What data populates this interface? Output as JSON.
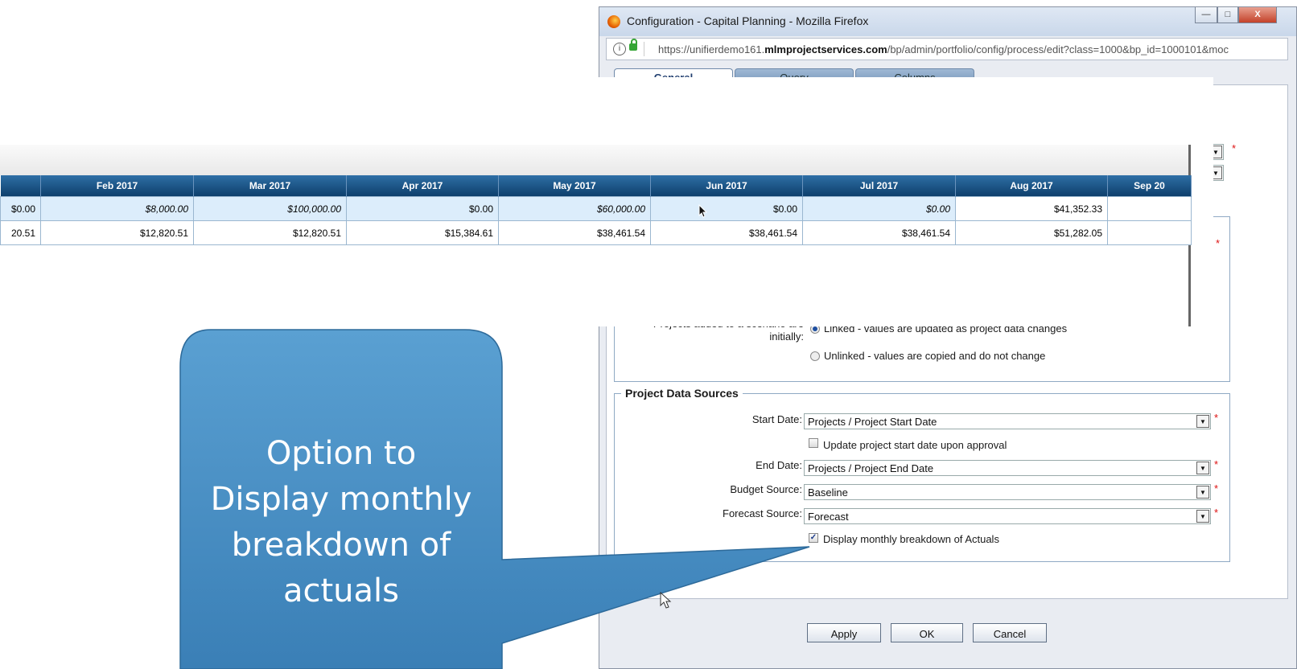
{
  "window": {
    "title": "Configuration - Capital Planning - Mozilla Firefox",
    "min": "—",
    "max": "□",
    "close": "X"
  },
  "url": {
    "prefix": "https://unifierdemo161.",
    "domain": "mlmprojectservices.com",
    "path": "/bp/admin/portfolio/config/process/edit?class=1000&bp_id=1000101&moc"
  },
  "tabs": [
    "General",
    "Query",
    "Columns"
  ],
  "scenario": {
    "label_line1": "Projects added to a scenario are",
    "label_line2": "initially:",
    "options": [
      "Linked - values are updated as project data changes",
      "Unlinked - values are copied and do not change"
    ],
    "selected": 0
  },
  "data_sources": {
    "legend": "Project Data Sources",
    "start_date_label": "Start Date:",
    "start_date_value": "Projects / Project Start Date",
    "update_start_label": "Update project start date upon approval",
    "update_start_checked": false,
    "end_date_label": "End Date:",
    "end_date_value": "Projects / Project End Date",
    "budget_label": "Budget Source:",
    "budget_value": "Baseline",
    "forecast_label": "Forecast Source:",
    "forecast_value": "Forecast",
    "display_monthly_label": "Display monthly breakdown of Actuals",
    "display_monthly_checked": true,
    "required_mark": "*"
  },
  "buttons": {
    "apply": "Apply",
    "ok": "OK",
    "cancel": "Cancel"
  },
  "grid": {
    "columns": [
      "",
      "Feb 2017",
      "Mar 2017",
      "Apr 2017",
      "May 2017",
      "Jun 2017",
      "Jul 2017",
      "Aug 2017",
      "Sep 20"
    ],
    "row1": [
      "$0.00",
      "$8,000.00",
      "$100,000.00",
      "$0.00",
      "$60,000.00",
      "$0.00",
      "$0.00",
      "$41,352.33",
      ""
    ],
    "row2": [
      "20.51",
      "$12,820.51",
      "$12,820.51",
      "$15,384.61",
      "$38,461.54",
      "$38,461.54",
      "$38,461.54",
      "$51,282.05",
      ""
    ]
  },
  "callout": {
    "line1": "Option to",
    "line2": "Display monthly",
    "line3": "breakdown of",
    "line4": "actuals",
    "color": "#3d86be"
  }
}
